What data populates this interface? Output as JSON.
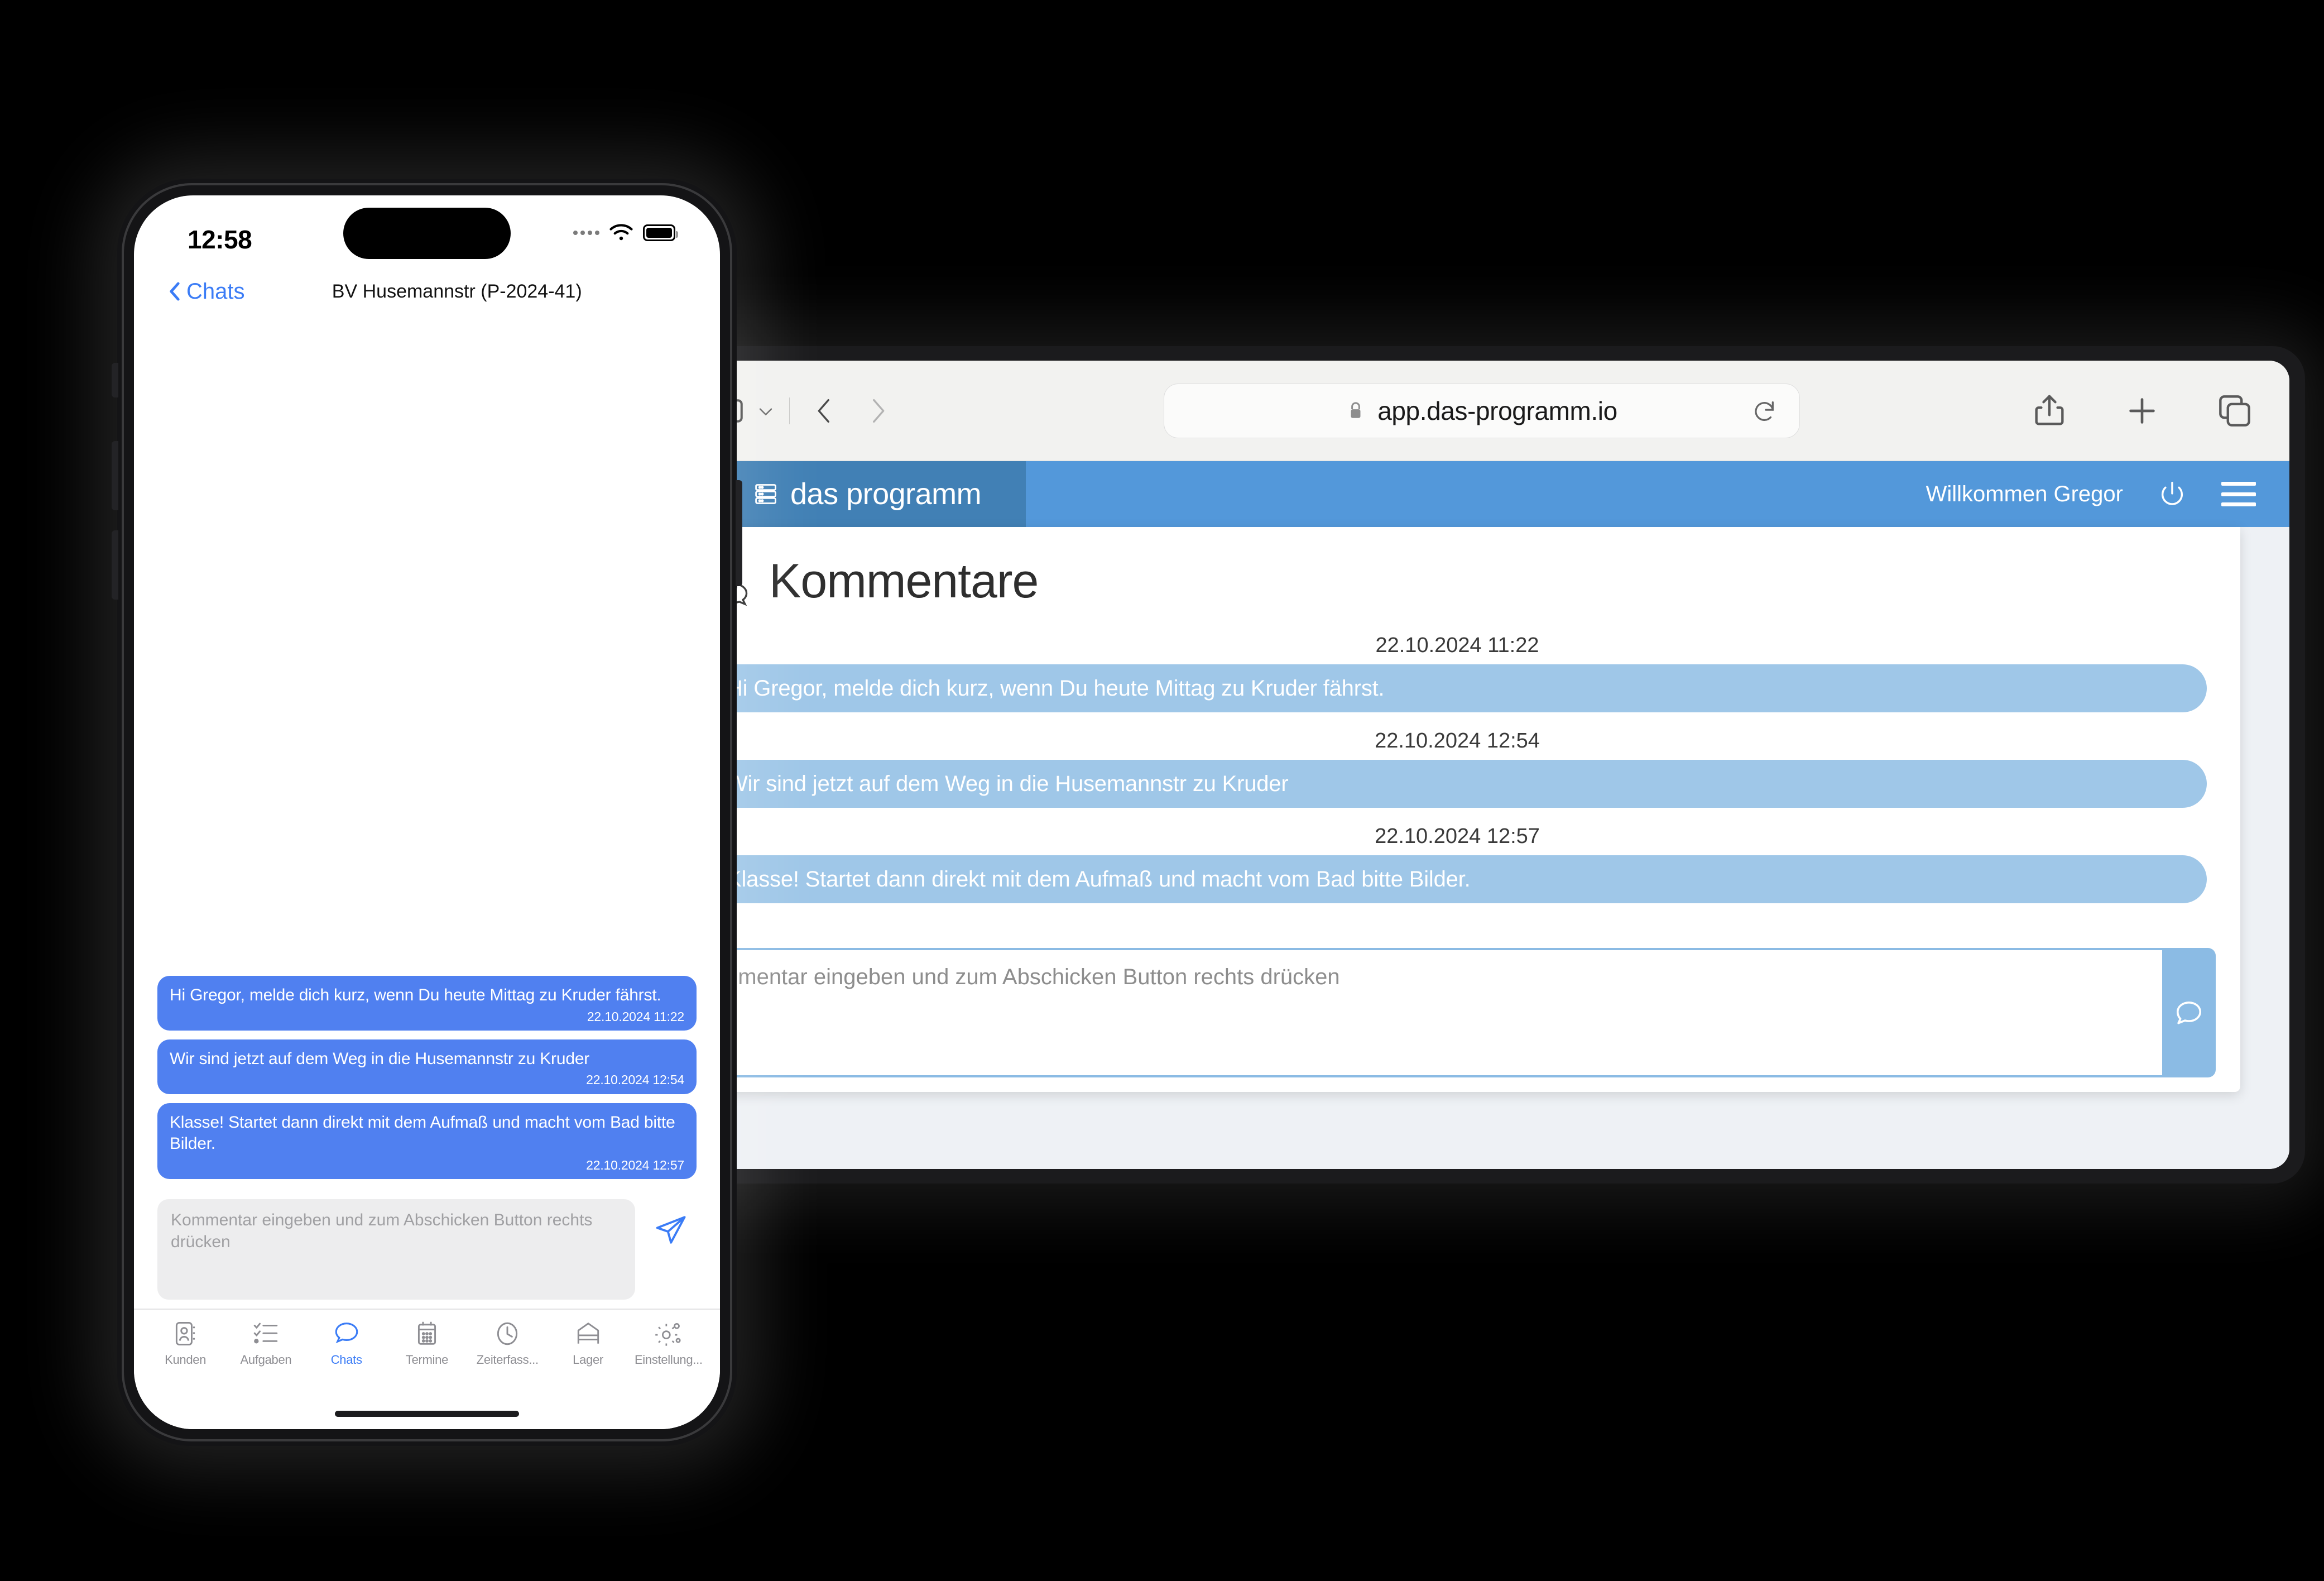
{
  "browser": {
    "url": "app.das-programm.io",
    "icons": {
      "sidebar": "sidebar-toggle-icon",
      "chevron_down": "chevron-down-icon",
      "back": "back-chevron-icon",
      "forward": "forward-chevron-icon",
      "lock": "lock-icon",
      "reload": "reload-icon",
      "share": "share-icon",
      "new_tab": "plus-icon",
      "tabs": "tab-overview-icon"
    }
  },
  "webapp": {
    "brand": "das programm",
    "brand_icon": "server-stack-icon",
    "welcome": "Willkommen Gregor",
    "power_icon": "power-icon",
    "menu_icon": "hamburger-menu-icon",
    "page_title": "Kommentare",
    "title_icon": "comments-icon",
    "colors": {
      "brand_dark": "#4180b5",
      "header": "#5398da",
      "bubble": "#9fc7e8",
      "border": "#8bbbe4"
    },
    "messages": [
      {
        "time": "22.10.2024 11:22",
        "text": "Hi Gregor, melde dich kurz, wenn Du heute Mittag zu Kruder fährst."
      },
      {
        "time": "22.10.2024 12:54",
        "text": "Wir sind jetzt auf dem Weg in die Husemannstr zu Kruder"
      },
      {
        "time": "22.10.2024 12:57",
        "text": "Klasse! Startet dann direkt mit dem Aufmaß und macht vom Bad bitte Bilder."
      }
    ],
    "composer": {
      "placeholder": "Kommentar eingeben und zum Abschicken Button rechts drücken",
      "value": "",
      "send_icon": "comment-send-icon"
    }
  },
  "phone": {
    "status": {
      "time": "12:58",
      "signal_icon": "signal-dots-icon",
      "wifi_icon": "wifi-icon",
      "battery_icon": "battery-full-icon"
    },
    "nav": {
      "back_label": "Chats",
      "back_icon": "back-chevron-icon",
      "title": "BV Husemannstr (P-2024-41)"
    },
    "messages": [
      {
        "text": "Hi Gregor, melde dich kurz, wenn Du heute Mittag zu Kruder fährst.",
        "time": "22.10.2024 11:22"
      },
      {
        "text": "Wir sind jetzt auf dem Weg in die Husemannstr zu Kruder",
        "time": "22.10.2024 12:54"
      },
      {
        "text": "Klasse! Startet dann direkt mit dem Aufmaß und macht vom Bad bitte Bilder.",
        "time": "22.10.2024 12:57"
      }
    ],
    "composer": {
      "placeholder": "Kommentar eingeben und zum Abschicken Button rechts drücken",
      "value": "",
      "send_icon": "paper-plane-icon"
    },
    "tabs": [
      {
        "label": "Kunden",
        "icon": "contact-card-icon",
        "active": false
      },
      {
        "label": "Aufgaben",
        "icon": "checklist-icon",
        "active": false
      },
      {
        "label": "Chats",
        "icon": "chat-bubble-icon",
        "active": true
      },
      {
        "label": "Termine",
        "icon": "calendar-icon",
        "active": false
      },
      {
        "label": "Zeiterfass...",
        "icon": "clock-icon",
        "active": false
      },
      {
        "label": "Lager",
        "icon": "warehouse-icon",
        "active": false
      },
      {
        "label": "Einstellung...",
        "icon": "gears-icon",
        "active": false
      }
    ],
    "accent": "#3b7cf6",
    "bubble_color": "#5080f0"
  }
}
